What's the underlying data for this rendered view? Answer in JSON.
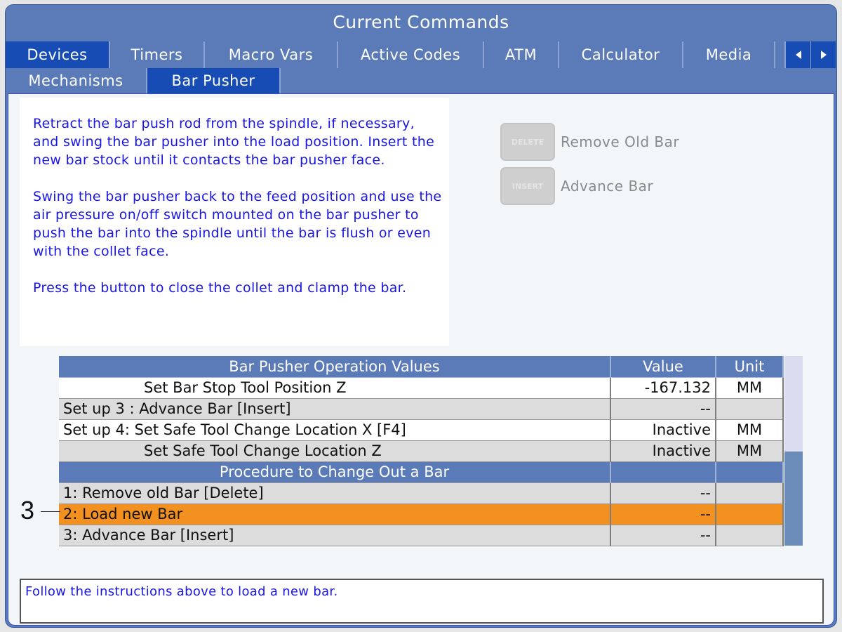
{
  "window": {
    "title": "Current Commands"
  },
  "tabs_row1": [
    {
      "label": "Devices",
      "active": true
    },
    {
      "label": "Timers",
      "active": false
    },
    {
      "label": "Macro Vars",
      "active": false
    },
    {
      "label": "Active Codes",
      "active": false
    },
    {
      "label": "ATM",
      "active": false
    },
    {
      "label": "Calculator",
      "active": false
    },
    {
      "label": "Media",
      "active": false
    }
  ],
  "tabs_row2": [
    {
      "label": "Mechanisms",
      "active": false
    },
    {
      "label": "Bar Pusher",
      "active": true
    }
  ],
  "instructions": {
    "paragraph1": "Retract the bar push rod from the spindle, if necessary, and swing the bar pusher into the load position. Insert the new bar stock until it contacts the bar pusher face.",
    "paragraph2": "Swing the bar pusher back to the feed position and use the air pressure on/off switch mounted on the bar pusher to push the bar into the spindle until the bar is flush or even with the collet face.",
    "paragraph3": "Press the button to close the collet and clamp the bar."
  },
  "keys": [
    {
      "key": "DELETE",
      "label": "Remove Old Bar"
    },
    {
      "key": "INSERT",
      "label": "Advance Bar"
    }
  ],
  "table": {
    "headers": [
      "Bar Pusher Operation Values",
      "Value",
      "Unit"
    ],
    "rows": [
      {
        "name": "Set Bar Stop Tool Position Z",
        "value": "-167.132",
        "unit": "MM"
      },
      {
        "name": "Set up 3 : Advance Bar [Insert]",
        "value": "--",
        "unit": ""
      },
      {
        "name": "Set up 4: Set Safe Tool Change Location X [F4]",
        "value": "Inactive",
        "unit": "MM"
      },
      {
        "name": "Set Safe Tool Change Location Z",
        "value": "Inactive",
        "unit": "MM"
      },
      {
        "name": "Procedure to Change Out a Bar",
        "value": "",
        "unit": ""
      },
      {
        "name": "1: Remove old Bar [Delete]",
        "value": "--",
        "unit": ""
      },
      {
        "name": "2: Load new Bar",
        "value": "--",
        "unit": ""
      },
      {
        "name": "3: Advance Bar [Insert]",
        "value": "--",
        "unit": ""
      }
    ]
  },
  "callout": {
    "number": "3"
  },
  "message": {
    "text": "Follow the instructions above to load a new bar."
  },
  "colors": {
    "accent": "#5b7bb8",
    "active_tab": "#174cb5",
    "selected_row": "#f29120",
    "instruction_text": "#1a16e6"
  }
}
